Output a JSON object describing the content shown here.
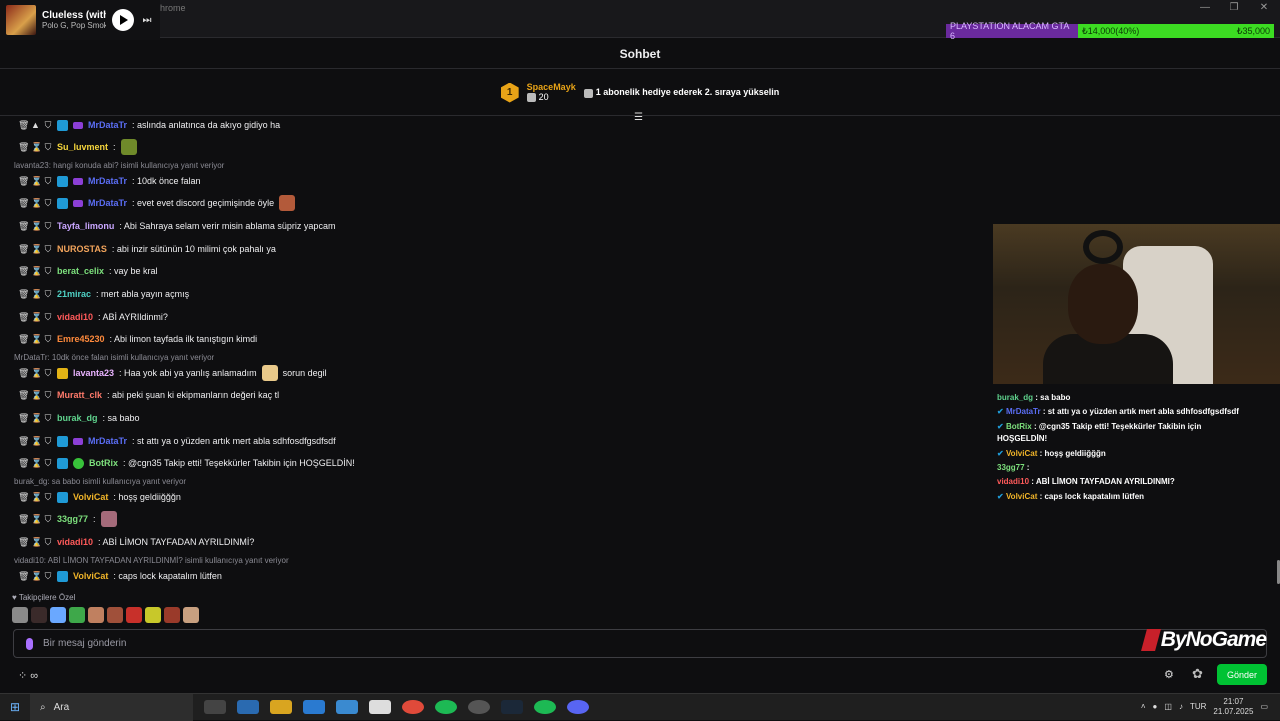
{
  "media": {
    "title": "Clueless (with",
    "artist": "Polo G, Pop Smok"
  },
  "browser": {
    "title_fragment": "hrome"
  },
  "goal": {
    "label": "PLAYSTATION ALACAM GTA 6",
    "current": "₺14,000(40%)",
    "target": "₺35,000"
  },
  "chat": {
    "header": "Sohbet",
    "leaderboard": {
      "rank": "1",
      "name": "SpaceMayk",
      "count": "20",
      "message": "1 abonelik hediye ederek 2. sıraya yükselin"
    },
    "rows": [
      {
        "user": "MrDataTr",
        "text": ": aslında anlatınca da akıyo gidiyo ha",
        "color": "#5b6ef5"
      },
      {
        "user": "Su_luvment",
        "text": ":",
        "color": "#f5d53c"
      },
      {
        "reply": "lavanta23: hangi konuda abi? isimli kullanıcıya yanıt veriyor"
      },
      {
        "user": "MrDataTr",
        "text": ": 10dk önce falan",
        "color": "#5b6ef5"
      },
      {
        "user": "MrDataTr",
        "text": ": evet evet discord geçimişinde öyle",
        "color": "#5b6ef5"
      },
      {
        "user": "Tayfa_limonu",
        "text": ": Abi Sahraya selam verir misin ablama süpriz yapcam",
        "color": "#c9a6ff"
      },
      {
        "user": "NUROSTAS",
        "text": ": abi inzir sütünün 10 milimi çok pahalı ya",
        "color": "#f2a45c"
      },
      {
        "user": "berat_celix",
        "text": ": vay be kral",
        "color": "#7de07d"
      },
      {
        "user": "21mirac",
        "text": ": mert abla yayın açmış",
        "color": "#4fd1c5"
      },
      {
        "user": "vidadi10",
        "text": ": ABİ AYRIldinmi?",
        "color": "#ff5a5a"
      },
      {
        "user": "Emre45230",
        "text": ": Abi limon tayfada ilk tanıştıgın kimdi",
        "color": "#ff8a3c"
      },
      {
        "reply": "MrDataTr: 10dk önce falan isimli kullanıcıya yanıt veriyor"
      },
      {
        "user": "lavanta23",
        "text": ": Haa yok abi ya yanlış anlamadım",
        "tail": "sorun degil",
        "color": "#e9b3ff"
      },
      {
        "user": "Muratt_clk",
        "text": ": abi peki şuan ki ekipmanların değeri kaç tl",
        "color": "#ff7a6b"
      },
      {
        "user": "burak_dg",
        "text": ": sa babo",
        "color": "#5fd38d"
      },
      {
        "user": "MrDataTr",
        "text": ": st attı ya o yüzden artık mert abla sdhfosdfgsdfsdf",
        "color": "#5b6ef5"
      },
      {
        "user": "BotRix",
        "text": ": @cgn35 Takip etti! Teşekkürler Takibin için HOŞGELDİN!",
        "color": "#7de07d"
      },
      {
        "reply": "burak_dg: sa babo isimli kullanıcıya yanıt veriyor"
      },
      {
        "user": "VolviCat",
        "text": ": hoşş geldiiğğğn",
        "color": "#f0b429"
      },
      {
        "user": "33gg77",
        "text": ":",
        "color": "#7de07d"
      },
      {
        "user": "vidadi10",
        "text": ": ABİ LİMON TAYFADAN AYRILDINMİ?",
        "color": "#ff5a5a"
      },
      {
        "reply": "vidadi10: ABİ LİMON TAYFADAN AYRILDINMİ? isimli kullanıcıya yanıt veriyor"
      },
      {
        "user": "VolviCat",
        "text": ": caps lock kapatalım lütfen",
        "color": "#f0b429"
      }
    ],
    "followers_label": "Takipçilere Özel",
    "input_placeholder": "Bir mesaj gönderin",
    "send_label": "Gönder",
    "watermark": "ByNoGame"
  },
  "overlay": [
    {
      "user": "burak_dg",
      "text": " : sa babo",
      "color": "#5fd38d"
    },
    {
      "user": "MrDataTr",
      "text": " : st attı ya o yüzden artık mert abla sdhfosdfgsdfsdf",
      "color": "#5b6ef5"
    },
    {
      "user": "BotRix",
      "text": " : @cgn35 Takip etti! Teşekkürler Takibin için",
      "color": "#7de07d"
    },
    {
      "user": "",
      "text": "HOŞGELDİN!",
      "color": "#fff"
    },
    {
      "user": "VolviCat",
      "text": " : hoşş geldiiğğğn",
      "color": "#f0b429"
    },
    {
      "user": "33gg77",
      "text": " :",
      "color": "#7de07d"
    },
    {
      "user": "vidadi10",
      "text": " : ABİ LİMON TAYFADAN AYRILDINMI?",
      "color": "#ff5a5a"
    },
    {
      "user": "VolviCat",
      "text": " : caps lock kapatalım lütfen",
      "color": "#f0b429"
    }
  ],
  "taskbar": {
    "search_placeholder": "Ara",
    "lang": "TUR",
    "time": "21:07",
    "date": "21.07.2025"
  }
}
